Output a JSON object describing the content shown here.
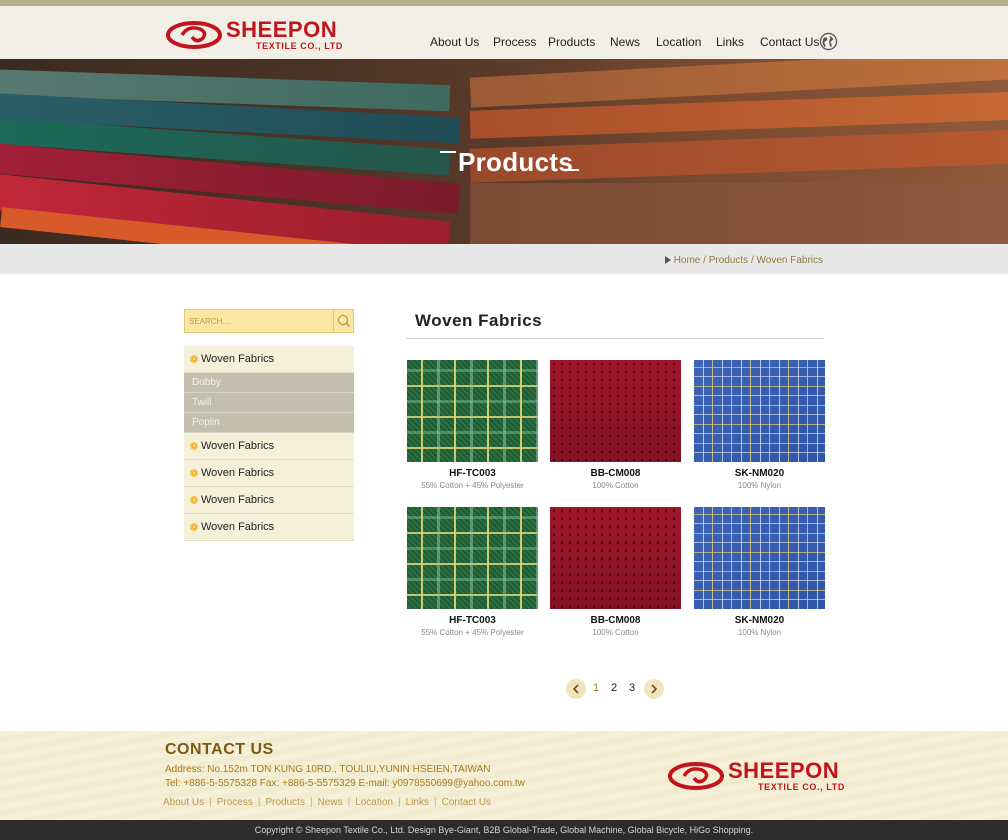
{
  "brand": {
    "name": "SHEEPON",
    "subtitle": "TEXTILE CO., LTD",
    "color": "#c2141c"
  },
  "nav": {
    "items": [
      {
        "label": "About Us"
      },
      {
        "label": "Process"
      },
      {
        "label": "Products"
      },
      {
        "label": "News"
      },
      {
        "label": "Location"
      },
      {
        "label": "Links"
      },
      {
        "label": "Contact Us"
      }
    ],
    "language_icon": "globe-icon"
  },
  "hero": {
    "title": "Products"
  },
  "breadcrumb": {
    "text": "Home / Products / Woven Fabrics"
  },
  "search": {
    "placeholder": "SEARCH....",
    "icon": "search-icon"
  },
  "sidebar": {
    "categories": [
      {
        "label": "Woven Fabrics",
        "sub": [
          "Dobby",
          "Twill",
          "Poplin"
        ]
      },
      {
        "label": "Woven Fabrics"
      },
      {
        "label": "Woven Fabrics"
      },
      {
        "label": "Woven Fabrics"
      },
      {
        "label": "Woven Fabrics"
      }
    ]
  },
  "main": {
    "title": "Woven  Fabrics",
    "products": [
      {
        "code": "HF-TC003",
        "desc": "55% Cotton + 45% Polyester",
        "swatch": "green"
      },
      {
        "code": "BB-CM008",
        "desc": "100% Cotton",
        "swatch": "red"
      },
      {
        "code": "SK-NM020",
        "desc": "100% Nylon",
        "swatch": "blue"
      },
      {
        "code": "HF-TC003",
        "desc": "55% Cotton + 45% Polyester",
        "swatch": "green"
      },
      {
        "code": "BB-CM008",
        "desc": "100% Cotton",
        "swatch": "red"
      },
      {
        "code": "SK-NM020",
        "desc": "100% Nylon",
        "swatch": "blue"
      }
    ]
  },
  "pagination": {
    "pages": [
      "1",
      "2",
      "3"
    ],
    "current": "1",
    "prev_icon": "chevron-left-icon",
    "next_icon": "chevron-right-icon"
  },
  "footer": {
    "contact_title": "CONTACT  US",
    "address": "Address: No.152m TON KUNG 10RD., TOULIU,YUNIN HSEIEN,TAIWAN",
    "phone_line": "Tel: +886-5-5575328   Fax: +886-5-5575329  E-mail: y0978550699@yahoo.com.tw",
    "links": [
      "About Us",
      "Process",
      "Products",
      "News",
      "Location",
      "Links",
      "Contact Us"
    ]
  },
  "copyright": "Copyright © Sheepon Textile Co., Ltd. Design Bye-Giant, B2B Global-Trade, Global Machine, Global Bicycle, HiGo Shopping."
}
